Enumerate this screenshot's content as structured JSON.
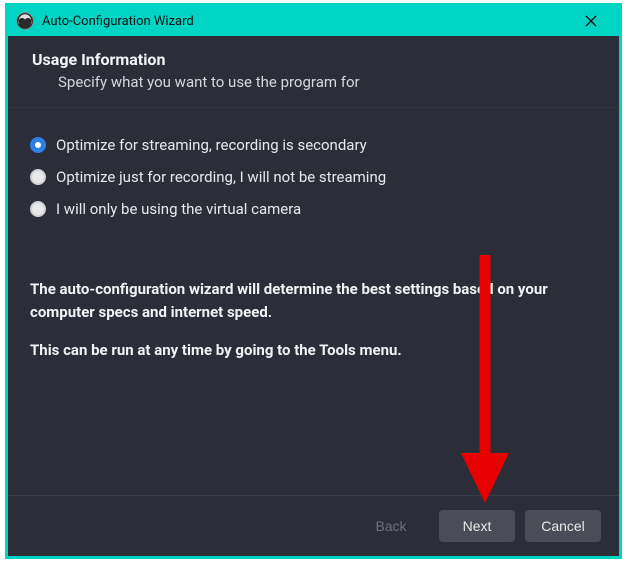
{
  "window": {
    "title": "Auto-Configuration Wizard"
  },
  "header": {
    "heading": "Usage Information",
    "subheading": "Specify what you want to use the program for"
  },
  "options": {
    "items": [
      {
        "label": "Optimize for streaming, recording is secondary",
        "selected": true
      },
      {
        "label": "Optimize just for recording, I will not be streaming",
        "selected": false
      },
      {
        "label": "I will only be using the virtual camera",
        "selected": false
      }
    ]
  },
  "info": {
    "line1": "The auto-configuration wizard will determine the best settings based on your computer specs and internet speed.",
    "line2": "This can be run at any time by going to the Tools menu."
  },
  "buttons": {
    "back": "Back",
    "next": "Next",
    "cancel": "Cancel"
  }
}
